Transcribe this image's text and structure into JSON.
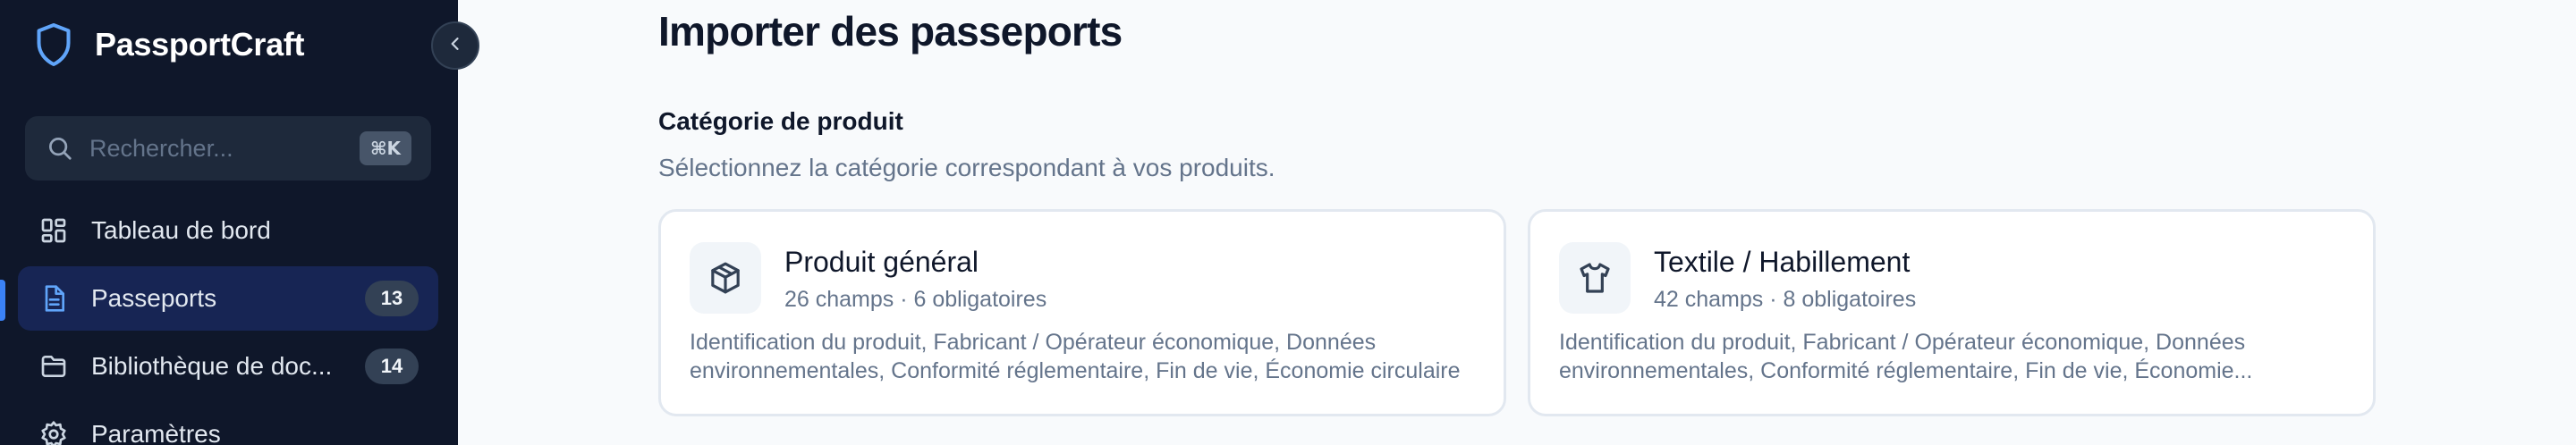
{
  "app": {
    "name": "PassportCraft"
  },
  "search": {
    "placeholder": "Rechercher...",
    "shortcut": "⌘K"
  },
  "nav": {
    "items": [
      {
        "label": "Tableau de bord",
        "icon": "dashboard-icon"
      },
      {
        "label": "Passeports",
        "badge": "13",
        "icon": "document-icon",
        "active": true
      },
      {
        "label": "Bibliothèque de doc...",
        "badge": "14",
        "icon": "folder-icon"
      },
      {
        "label": "Paramètres",
        "icon": "gear-icon"
      }
    ]
  },
  "main": {
    "title": "Importer des passeports",
    "section": {
      "label": "Catégorie de produit",
      "description": "Sélectionnez la catégorie correspondant à vos produits."
    },
    "categories": [
      {
        "title": "Produit général",
        "meta": "26 champs · 6 obligatoires",
        "description": "Identification du produit, Fabricant / Opérateur économique, Données environnementales, Conformité réglementaire, Fin de vie, Économie circulaire",
        "icon": "package-icon"
      },
      {
        "title": "Textile / Habillement",
        "meta": "42 champs · 8 obligatoires",
        "description": "Identification du produit, Fabricant / Opérateur économique, Données environnementales, Conformité réglementaire, Fin de vie, Économie...",
        "icon": "shirt-icon"
      }
    ]
  },
  "colors": {
    "sidebar_bg": "#0f172a",
    "accent": "#3b82f6",
    "active_bg": "#172554",
    "page_bg": "#f8fafc"
  }
}
